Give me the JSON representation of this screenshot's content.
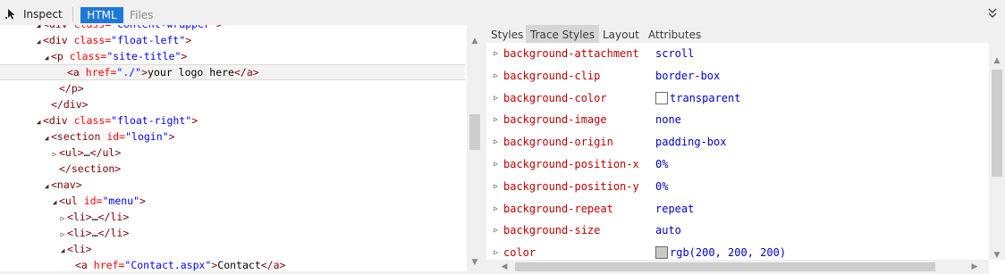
{
  "toolbar": {
    "inspect_label": "Inspect",
    "tabs": [
      "HTML",
      "Files"
    ],
    "inspect_icon": "cursor-icon",
    "collapse_icon": "double-chevron-down-icon",
    "accent": "#1e78d7"
  },
  "dom_tree": {
    "lines": [
      {
        "indent": 4,
        "twisty": "expanded",
        "selected": false,
        "tokens": [
          {
            "c": "t",
            "v": "<div "
          },
          {
            "c": "an",
            "v": "class="
          },
          {
            "c": "av",
            "v": "\"content-wrapper\""
          },
          {
            "c": "t",
            "v": ">"
          }
        ]
      },
      {
        "indent": 4,
        "twisty": "expanded",
        "selected": false,
        "tokens": [
          {
            "c": "t",
            "v": "<div "
          },
          {
            "c": "an",
            "v": "class="
          },
          {
            "c": "av",
            "v": "\"float-left\""
          },
          {
            "c": "t",
            "v": ">"
          }
        ]
      },
      {
        "indent": 5,
        "twisty": "expanded",
        "selected": false,
        "tokens": [
          {
            "c": "t",
            "v": "<p "
          },
          {
            "c": "an",
            "v": "class="
          },
          {
            "c": "av",
            "v": "\"site-title\""
          },
          {
            "c": "t",
            "v": ">"
          }
        ]
      },
      {
        "indent": 7,
        "twisty": "none",
        "selected": true,
        "tokens": [
          {
            "c": "t",
            "v": "<a "
          },
          {
            "c": "an",
            "v": "href="
          },
          {
            "c": "av",
            "v": "\"./\""
          },
          {
            "c": "t",
            "v": ">"
          },
          {
            "c": "tx",
            "v": "your logo here"
          },
          {
            "c": "t",
            "v": "</a>"
          }
        ]
      },
      {
        "indent": 6,
        "twisty": "none",
        "selected": false,
        "tokens": [
          {
            "c": "t",
            "v": "</p>"
          }
        ]
      },
      {
        "indent": 5,
        "twisty": "none",
        "selected": false,
        "tokens": [
          {
            "c": "t",
            "v": "</div>"
          }
        ]
      },
      {
        "indent": 4,
        "twisty": "expanded",
        "selected": false,
        "tokens": [
          {
            "c": "t",
            "v": "<div "
          },
          {
            "c": "an",
            "v": "class="
          },
          {
            "c": "av",
            "v": "\"float-right\""
          },
          {
            "c": "t",
            "v": ">"
          }
        ]
      },
      {
        "indent": 5,
        "twisty": "expanded",
        "selected": false,
        "tokens": [
          {
            "c": "t",
            "v": "<section "
          },
          {
            "c": "an",
            "v": "id="
          },
          {
            "c": "av",
            "v": "\"login\""
          },
          {
            "c": "t",
            "v": ">"
          }
        ]
      },
      {
        "indent": 6,
        "twisty": "collapsed",
        "selected": false,
        "tokens": [
          {
            "c": "t",
            "v": "<ul>"
          },
          {
            "c": "tx",
            "v": "…"
          },
          {
            "c": "t",
            "v": "</ul>"
          }
        ]
      },
      {
        "indent": 6,
        "twisty": "none",
        "selected": false,
        "tokens": [
          {
            "c": "t",
            "v": "</section>"
          }
        ]
      },
      {
        "indent": 5,
        "twisty": "expanded",
        "selected": false,
        "tokens": [
          {
            "c": "t",
            "v": "<nav>"
          }
        ]
      },
      {
        "indent": 6,
        "twisty": "expanded",
        "selected": false,
        "tokens": [
          {
            "c": "t",
            "v": "<ul "
          },
          {
            "c": "an",
            "v": "id="
          },
          {
            "c": "av",
            "v": "\"menu\""
          },
          {
            "c": "t",
            "v": ">"
          }
        ]
      },
      {
        "indent": 7,
        "twisty": "collapsed",
        "selected": false,
        "tokens": [
          {
            "c": "t",
            "v": "<li>"
          },
          {
            "c": "tx",
            "v": "…"
          },
          {
            "c": "t",
            "v": "</li>"
          }
        ]
      },
      {
        "indent": 7,
        "twisty": "collapsed",
        "selected": false,
        "tokens": [
          {
            "c": "t",
            "v": "<li>"
          },
          {
            "c": "tx",
            "v": "…"
          },
          {
            "c": "t",
            "v": "</li>"
          }
        ]
      },
      {
        "indent": 7,
        "twisty": "expanded",
        "selected": false,
        "tokens": [
          {
            "c": "t",
            "v": "<li>"
          }
        ]
      },
      {
        "indent": 8,
        "twisty": "none",
        "selected": false,
        "tokens": [
          {
            "c": "t",
            "v": "<a "
          },
          {
            "c": "an",
            "v": "href="
          },
          {
            "c": "av",
            "v": "\"Contact.aspx\""
          },
          {
            "c": "t",
            "v": ">"
          },
          {
            "c": "tx",
            "v": "Contact"
          },
          {
            "c": "t",
            "v": "</a>"
          }
        ]
      }
    ]
  },
  "styles_panel": {
    "tabs": [
      {
        "label": "Styles",
        "active": false
      },
      {
        "label": "Trace Styles",
        "active": true
      },
      {
        "label": "Layout",
        "active": false
      },
      {
        "label": "Attributes",
        "active": false
      }
    ],
    "properties": [
      {
        "name": "background-attachment",
        "value": "scroll"
      },
      {
        "name": "background-clip",
        "value": "border-box"
      },
      {
        "name": "background-color",
        "value": "transparent",
        "swatch": "#ffffff"
      },
      {
        "name": "background-image",
        "value": "none"
      },
      {
        "name": "background-origin",
        "value": "padding-box"
      },
      {
        "name": "background-position-x",
        "value": "0%"
      },
      {
        "name": "background-position-y",
        "value": "0%"
      },
      {
        "name": "background-repeat",
        "value": "repeat"
      },
      {
        "name": "background-size",
        "value": "auto"
      },
      {
        "name": "color",
        "value": "rgb(200, 200, 200)",
        "swatch": "#c8c8c8"
      }
    ]
  }
}
